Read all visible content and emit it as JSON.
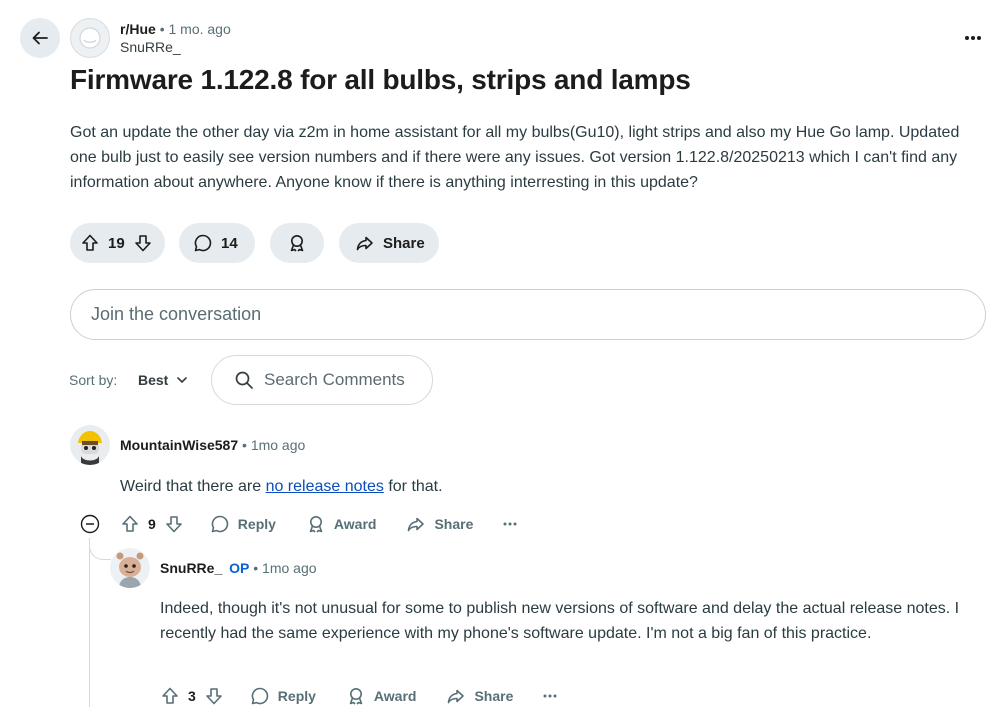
{
  "post": {
    "subreddit": "r/Hue",
    "separator": "•",
    "age": "1 mo. ago",
    "author": "SnuRRe_",
    "title": "Firmware 1.122.8 for all bulbs, strips and lamps",
    "body": "Got an update the other day via z2m in home assistant for all my bulbs(Gu10), light strips and also my Hue Go lamp. Updated one bulb just to easily see version numbers and if there were any issues. Got version 1.122.8/20250213 which I can't find any information about anywhere. Anyone know if there is anything interresting in this update?",
    "votes": "19",
    "comments": "14",
    "share_label": "Share"
  },
  "composer": {
    "placeholder": "Join the conversation"
  },
  "sort": {
    "label": "Sort by:",
    "value": "Best"
  },
  "search": {
    "placeholder": "Search Comments"
  },
  "comments": [
    {
      "username": "MountainWise587",
      "separator": "•",
      "age": "1mo ago",
      "text_before": "Weird that there are ",
      "link_text": "no release notes",
      "text_after": " for that.",
      "votes": "9",
      "reply_label": "Reply",
      "award_label": "Award",
      "share_label": "Share"
    },
    {
      "username": "SnuRRe_",
      "op_badge": "OP",
      "separator": "•",
      "age": "1mo ago",
      "text": "Indeed, though it's not unusual for some to publish new versions of software and delay the actual release notes. I recently had the same experience with my phone's software update. I'm not a big fan of this practice.",
      "votes": "3",
      "reply_label": "Reply",
      "award_label": "Award",
      "share_label": "Share"
    }
  ],
  "colors": {
    "pill_bg": "#e5ebee",
    "meta_text": "#576f76",
    "link": "#0a4dbf",
    "op_badge": "#0a5fd1"
  },
  "icons": [
    "back-arrow-icon",
    "subreddit-icon",
    "more-options-icon",
    "upvote-icon",
    "downvote-icon",
    "comment-icon",
    "award-icon",
    "share-icon",
    "search-icon",
    "chevron-down-icon",
    "collapse-icon"
  ]
}
